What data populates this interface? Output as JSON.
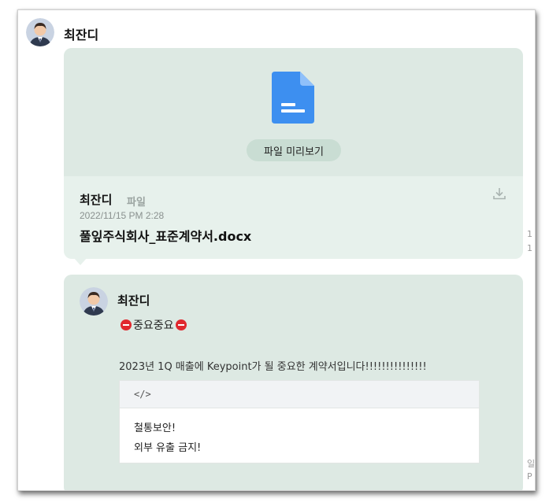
{
  "chat": {
    "sender_name": "최잔디",
    "file_message": {
      "preview_button": "파일 미리보기",
      "sender_name": "최잔디",
      "type_label": "파일",
      "timestamp": "2022/11/15 PM 2:28",
      "filename": "풀잎주식회사_표준계약서.docx",
      "file_icon_color": "#3d8ff0"
    },
    "text_message": {
      "sender_name": "최잔디",
      "important_label": "중요중요",
      "body": "2023년 1Q 매출에 Keypoint가 될 중요한 계약서입니다!!!!!!!!!!!!!!!",
      "code_header": "</>",
      "code_lines": [
        "철통보안!",
        "외부 유출 금지!"
      ]
    },
    "side_fragments": {
      "a": "1",
      "b": "1",
      "c": "일",
      "d": "P"
    }
  }
}
